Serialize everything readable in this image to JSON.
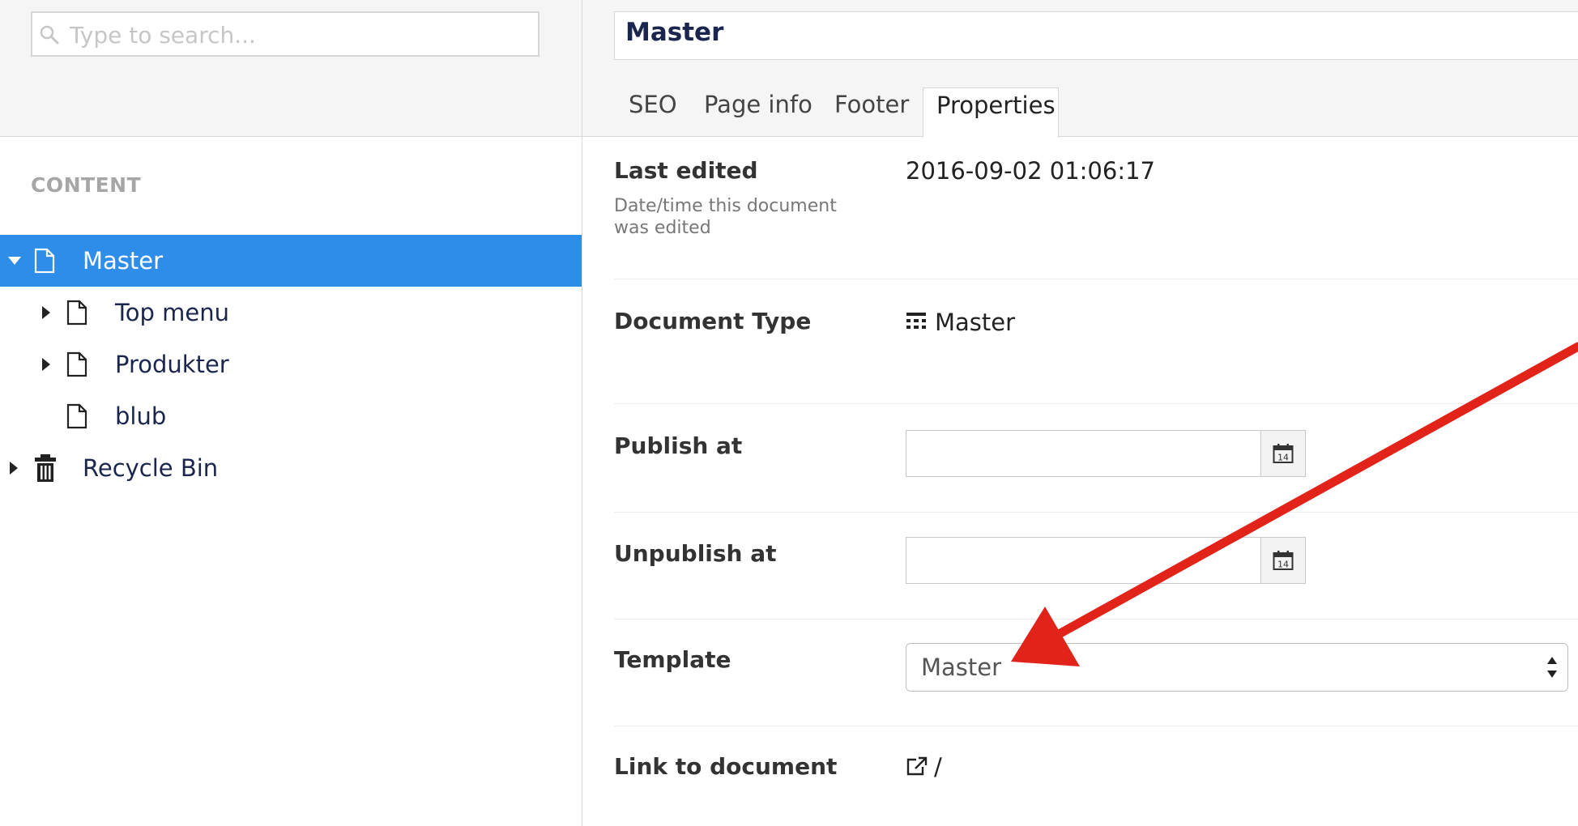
{
  "sidebar": {
    "search_placeholder": "Type to search...",
    "section_label": "CONTENT",
    "tree": [
      {
        "label": "Master",
        "selected": true,
        "expanded": true,
        "icon": "document-icon"
      },
      {
        "label": "Top menu",
        "icon": "document-icon"
      },
      {
        "label": "Produkter",
        "icon": "document-icon"
      },
      {
        "label": "blub",
        "icon": "document-icon"
      },
      {
        "label": "Recycle Bin",
        "icon": "trash-icon"
      }
    ]
  },
  "header": {
    "title_value": "Master",
    "tabs": [
      {
        "label": "SEO"
      },
      {
        "label": "Page info"
      },
      {
        "label": "Footer"
      },
      {
        "label": "Properties",
        "active": true
      }
    ]
  },
  "properties": {
    "last_edited": {
      "label": "Last edited",
      "description": "Date/time this document was edited",
      "value": "2016-09-02 01:06:17"
    },
    "document_type": {
      "label": "Document Type",
      "value": "Master",
      "icon": "doctype-grid-icon"
    },
    "publish_at": {
      "label": "Publish at",
      "value": "",
      "icon": "calendar-icon"
    },
    "unpublish_at": {
      "label": "Unpublish at",
      "value": "",
      "icon": "calendar-icon"
    },
    "template": {
      "label": "Template",
      "value": "Master"
    },
    "link_to_document": {
      "label": "Link to document",
      "value": "/",
      "icon": "external-link-icon"
    }
  },
  "colors": {
    "selected_row": "#2e8de8",
    "annotation_arrow": "#e2231a"
  }
}
